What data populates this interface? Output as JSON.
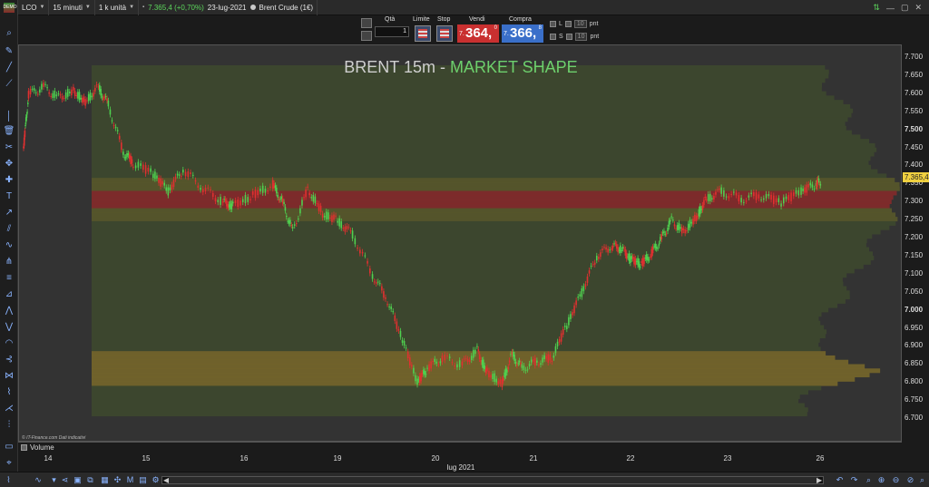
{
  "toolbar": {
    "logo_text": "DEMO",
    "symbol": "LCO",
    "timeframe": "15 minuti",
    "units": "1 k unità",
    "last_price": "7.365,4 (+0,70%)",
    "date": "23-lug-2021",
    "instrument": "Brent Crude (1€)",
    "accent_up": "#5cd65c"
  },
  "order": {
    "qty_label": "Qtà",
    "qty_value": "1",
    "limit_label": "Limite",
    "stop_label": "Stop",
    "sell_label": "Vendi",
    "buy_label": "Compra",
    "sell_prefix": "7.",
    "sell_big": "364,",
    "sell_sup": "0",
    "buy_prefix": "7.",
    "buy_big": "366,",
    "buy_sup": "8",
    "l_label": "L",
    "l_value": "10",
    "l_unit": "pnt",
    "s_label": "S",
    "s_value": "10",
    "s_unit": "pnt",
    "sell_color": "#c93030",
    "buy_color": "#3a6fc9"
  },
  "chart": {
    "title_part1": "BRENT 15m - ",
    "title_part2": "MARKET SHAPE",
    "title_accent": "#6dd06d",
    "price_tag": "7.365,4",
    "copyright": "© IT-Finance.com  Dati indicativi",
    "volume_label": "Volume",
    "month_label": "lug 2021"
  },
  "chart_data": {
    "type": "line",
    "style": "candlestick-like price series with volume profile",
    "ylim": [
      6.68,
      7.75
    ],
    "y_ticks": [
      "7.700",
      "7.650",
      "7.600",
      "7.550",
      "7.500",
      "7.450",
      "7.400",
      "7.350",
      "7.300",
      "7.250",
      "7.200",
      "7.150",
      "7.100",
      "7.050",
      "7.000",
      "6.950",
      "6.900",
      "6.850",
      "6.800",
      "6.750",
      "6.700"
    ],
    "y_ticks_bold": [
      "7.500",
      "7.000"
    ],
    "x_ticks": [
      {
        "label": "14",
        "pos": 0.0
      },
      {
        "label": "15",
        "pos": 1.0
      },
      {
        "label": "16",
        "pos": 2.0
      },
      {
        "label": "19",
        "pos": 3.0
      },
      {
        "label": "20",
        "pos": 4.0
      },
      {
        "label": "21",
        "pos": 5.0
      },
      {
        "label": "22",
        "pos": 6.0
      },
      {
        "label": "23",
        "pos": 7.0
      },
      {
        "label": "26",
        "pos": 8.0
      }
    ],
    "series": [
      {
        "values": [
          [
            0.0,
            7.45
          ],
          [
            0.05,
            7.6
          ],
          [
            0.2,
            7.62
          ],
          [
            0.35,
            7.59
          ],
          [
            0.5,
            7.61
          ],
          [
            0.62,
            7.58
          ],
          [
            0.75,
            7.62
          ],
          [
            0.85,
            7.57
          ],
          [
            1.0,
            7.44
          ],
          [
            1.1,
            7.41
          ],
          [
            1.3,
            7.38
          ],
          [
            1.45,
            7.33
          ],
          [
            1.6,
            7.39
          ],
          [
            1.8,
            7.34
          ],
          [
            2.0,
            7.3
          ],
          [
            2.1,
            7.29
          ],
          [
            2.3,
            7.32
          ],
          [
            2.5,
            7.35
          ],
          [
            2.6,
            7.3
          ],
          [
            2.7,
            7.22
          ],
          [
            2.85,
            7.34
          ],
          [
            3.0,
            7.27
          ],
          [
            3.15,
            7.25
          ],
          [
            3.3,
            7.21
          ],
          [
            3.5,
            7.1
          ],
          [
            3.65,
            7.03
          ],
          [
            3.8,
            6.92
          ],
          [
            3.95,
            6.8
          ],
          [
            4.05,
            6.84
          ],
          [
            4.2,
            6.87
          ],
          [
            4.4,
            6.85
          ],
          [
            4.55,
            6.89
          ],
          [
            4.65,
            6.83
          ],
          [
            4.8,
            6.8
          ],
          [
            4.9,
            6.88
          ],
          [
            5.0,
            6.84
          ],
          [
            5.15,
            6.86
          ],
          [
            5.3,
            6.87
          ],
          [
            5.45,
            6.96
          ],
          [
            5.6,
            7.05
          ],
          [
            5.75,
            7.15
          ],
          [
            5.9,
            7.18
          ],
          [
            6.0,
            7.17
          ],
          [
            6.1,
            7.14
          ],
          [
            6.2,
            7.13
          ],
          [
            6.3,
            7.16
          ],
          [
            6.4,
            7.2
          ],
          [
            6.5,
            7.25
          ],
          [
            6.62,
            7.22
          ],
          [
            6.75,
            7.26
          ],
          [
            6.85,
            7.31
          ],
          [
            7.0,
            7.33
          ],
          [
            7.2,
            7.31
          ],
          [
            7.4,
            7.32
          ],
          [
            7.6,
            7.3
          ],
          [
            7.8,
            7.33
          ],
          [
            7.95,
            7.35
          ],
          [
            8.0,
            7.36
          ]
        ]
      }
    ],
    "profile": {
      "poc": 7.31,
      "value_zone_low": [
        6.82,
        6.86
      ]
    },
    "grid": false,
    "legend": "none"
  },
  "bottom": {
    "icons": [
      "candle-icon",
      "chevron-down-icon",
      "share-icon",
      "layout-icon",
      "copy-icon",
      "grid-icon",
      "pattern-icon",
      "m-icon",
      "folder-icon",
      "settings-icon",
      "compare-icon"
    ],
    "right_icons": [
      "undo-icon",
      "redo-icon",
      "zoom-fit-icon",
      "zoom-in-icon",
      "zoom-out-icon",
      "zoom-region-icon"
    ]
  }
}
